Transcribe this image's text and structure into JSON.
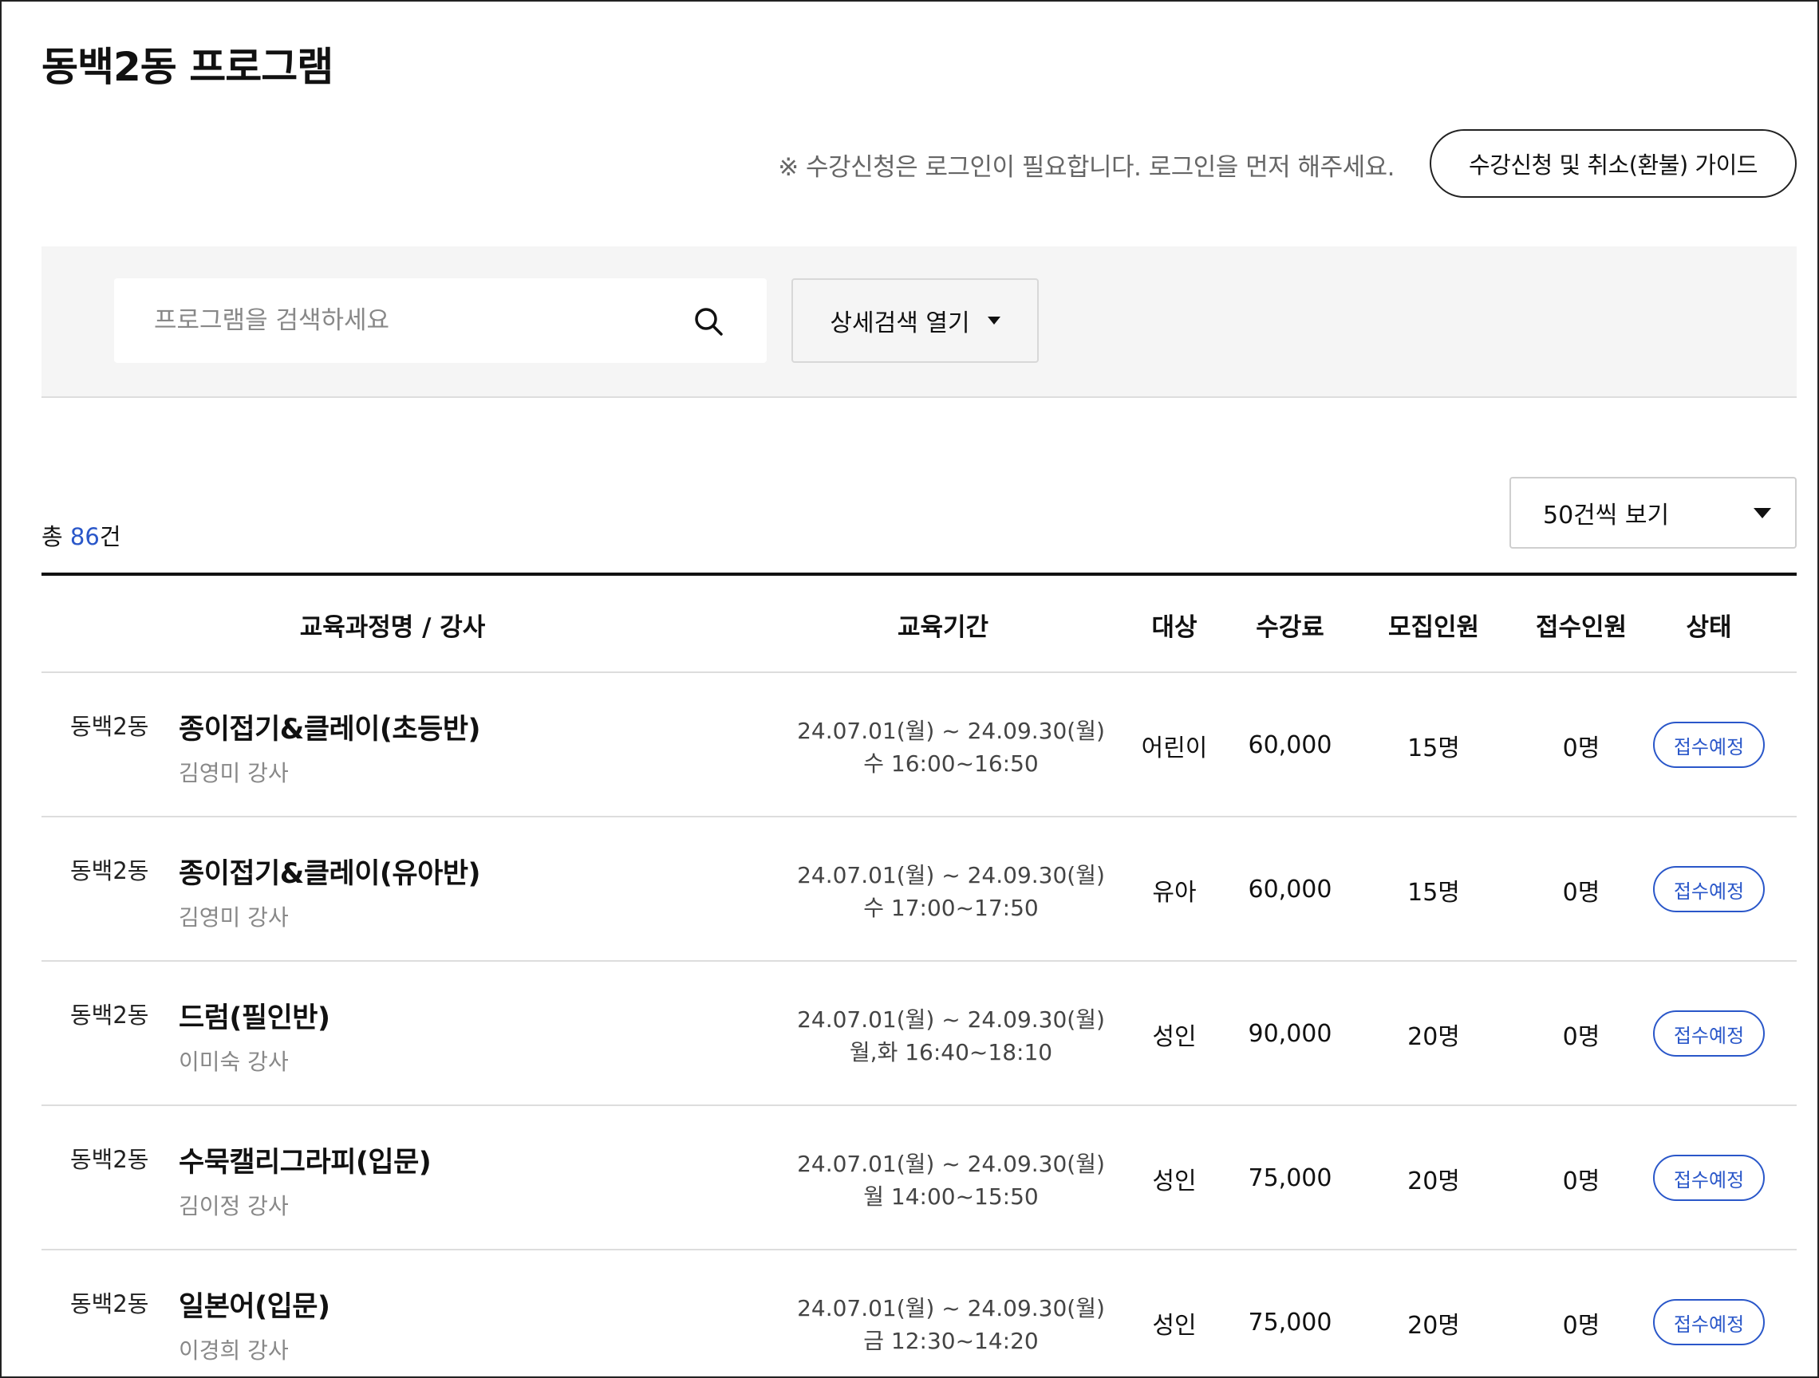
{
  "page": {
    "title": "동백2동 프로그램"
  },
  "notice": {
    "text": "※ 수강신청은 로그인이 필요합니다. 로그인을 먼저 해주세요.",
    "guide_button": "수강신청 및 취소(환불) 가이드"
  },
  "search": {
    "placeholder": "프로그램을 검색하세요",
    "icon": "search-icon",
    "detail_button": "상세검색 열기"
  },
  "summary": {
    "prefix": "총 ",
    "count": "86",
    "suffix": "건",
    "page_size": "50건씩 보기"
  },
  "table": {
    "headers": [
      "교육과정명 / 강사",
      "교육기간",
      "대상",
      "수강료",
      "모집인원",
      "접수인원",
      "상태"
    ],
    "rows": [
      {
        "dong": "동백2동",
        "course": "종이접기&클레이(초등반)",
        "teacher": "김영미 강사",
        "period": "24.07.01(월) ~ 24.09.30(월)",
        "schedule": "수 16:00~16:50",
        "target": "어린이",
        "fee": "60,000",
        "capacity": "15명",
        "applied": "0명",
        "status": "접수예정"
      },
      {
        "dong": "동백2동",
        "course": "종이접기&클레이(유아반)",
        "teacher": "김영미 강사",
        "period": "24.07.01(월) ~ 24.09.30(월)",
        "schedule": "수 17:00~17:50",
        "target": "유아",
        "fee": "60,000",
        "capacity": "15명",
        "applied": "0명",
        "status": "접수예정"
      },
      {
        "dong": "동백2동",
        "course": "드럼(필인반)",
        "teacher": "이미숙 강사",
        "period": "24.07.01(월) ~ 24.09.30(월)",
        "schedule": "월,화 16:40~18:10",
        "target": "성인",
        "fee": "90,000",
        "capacity": "20명",
        "applied": "0명",
        "status": "접수예정"
      },
      {
        "dong": "동백2동",
        "course": "수묵캘리그라피(입문)",
        "teacher": "김이정 강사",
        "period": "24.07.01(월) ~ 24.09.30(월)",
        "schedule": "월 14:00~15:50",
        "target": "성인",
        "fee": "75,000",
        "capacity": "20명",
        "applied": "0명",
        "status": "접수예정"
      },
      {
        "dong": "동백2동",
        "course": "일본어(입문)",
        "teacher": "이경희 강사",
        "period": "24.07.01(월) ~ 24.09.30(월)",
        "schedule": "금 12:30~14:20",
        "target": "성인",
        "fee": "75,000",
        "capacity": "20명",
        "applied": "0명",
        "status": "접수예정"
      }
    ]
  },
  "colors": {
    "accent": "#2a57c9",
    "text": "#111111",
    "muted": "#888888",
    "panel": "#f5f5f5"
  }
}
